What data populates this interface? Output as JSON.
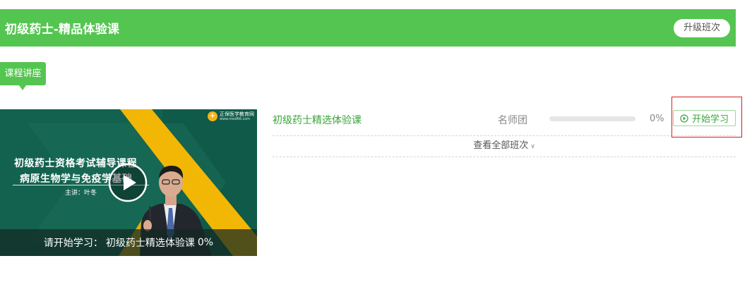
{
  "header": {
    "title": "初级药士-精品体验课",
    "upgrade_label": "升级班次"
  },
  "section_tag": "课程讲座",
  "thumbnail": {
    "logo_text": "正保医学教育网",
    "logo_url_text": "www.med66.com",
    "course_title_line1": "初级药士资格考试辅导课程",
    "course_title_line2": "病原生物学与免疫学基础",
    "lecturer": "主讲：叶冬",
    "caption_prefix": "请开始学习：",
    "caption_course": "初级药士精选体验课",
    "caption_percent": "0%"
  },
  "course_row": {
    "name": "初级药士精选体验课",
    "teacher": "名师团",
    "progress_percent": 0,
    "percent_label": "0%",
    "start_label": "开始学习"
  },
  "view_all": {
    "label": "查看全部班次",
    "icon": "chevron-down-icon"
  },
  "colors": {
    "brand_green": "#55c551",
    "link_green": "#3aa43a",
    "highlight_red": "#d32020"
  }
}
